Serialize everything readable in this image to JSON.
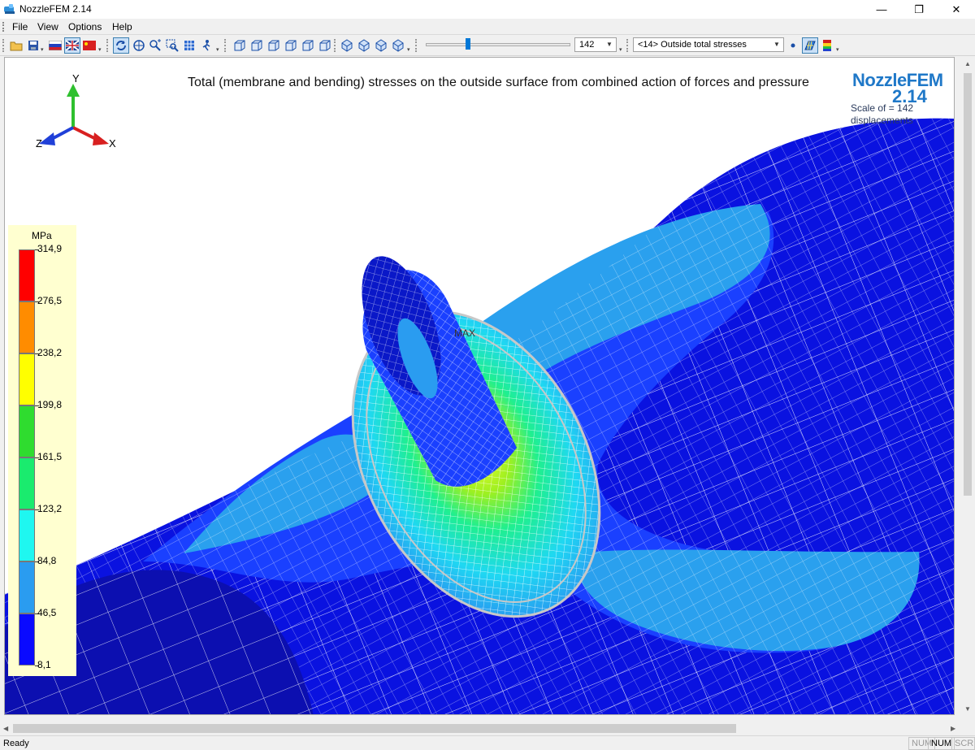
{
  "window": {
    "title": "NozzleFEM 2.14",
    "min_glyph": "—",
    "max_glyph": "❐",
    "close_glyph": "✕"
  },
  "menu": {
    "items": [
      "File",
      "View",
      "Options",
      "Help"
    ]
  },
  "toolbar": {
    "scale_value": "142",
    "stress_selector": "<14> Outside total stresses"
  },
  "viewport": {
    "plot_title": "Total (membrane and bending) stresses on the outside surface from combined action of forces and pressure",
    "brand_name": "NozzleFEM",
    "brand_version": "2.14",
    "scale_line1": "Scale of = 142",
    "scale_line2": "displacements",
    "max_marker": "MAX",
    "axes": {
      "x": "X",
      "y": "Y",
      "z": "Z"
    }
  },
  "legend": {
    "unit": "MPa",
    "labels": [
      "314,9",
      "276,5",
      "238,2",
      "199,8",
      "161,5",
      "123,2",
      "84,8",
      "46,5",
      "8,1"
    ],
    "colors": [
      "#ff0000",
      "#ff8c00",
      "#ffff00",
      "#2fdc2f",
      "#1aeb6e",
      "#1ff7f0",
      "#2a9cf0",
      "#0a0aff"
    ]
  },
  "status": {
    "text": "Ready",
    "panes": [
      "NUM",
      "NUM",
      "SCRL"
    ]
  },
  "colors": {
    "accent": "#1f78c8",
    "mesh_dark": "#0a12e0",
    "mesh_mid": "#1a40ff",
    "mesh_light": "#2aa0ee"
  }
}
